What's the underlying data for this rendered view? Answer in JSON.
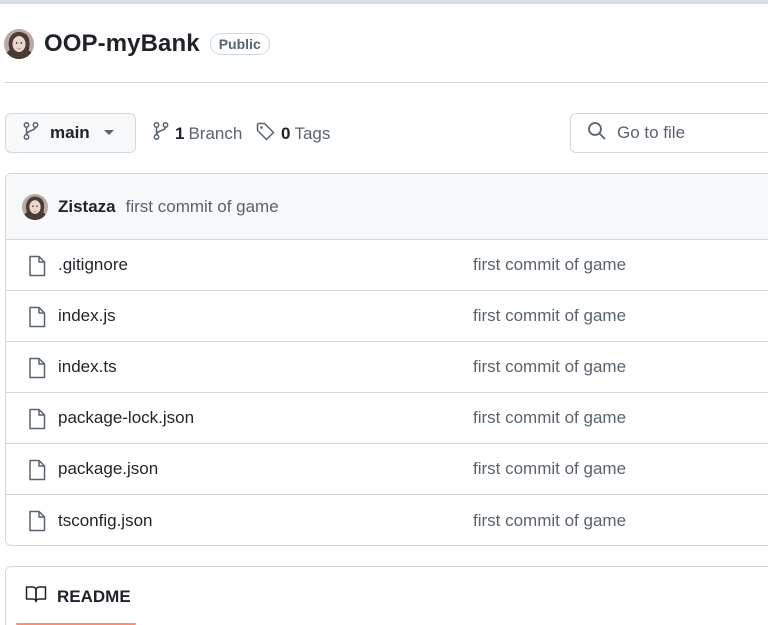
{
  "repo": {
    "name": "OOP-myBank",
    "visibility": "Public",
    "owner_avatar": "avatar"
  },
  "toolbar": {
    "branch": "main",
    "branch_count": "1",
    "branch_word": "Branch",
    "tag_count": "0",
    "tag_word": "Tags",
    "search_placeholder": "Go to file"
  },
  "commit": {
    "author": "Zistaza",
    "message": "first commit of game"
  },
  "files": [
    {
      "name": ".gitignore",
      "commit": "first commit of game",
      "icon": "file-icon"
    },
    {
      "name": "index.js",
      "commit": "first commit of game",
      "icon": "file-icon"
    },
    {
      "name": "index.ts",
      "commit": "first commit of game",
      "icon": "file-icon"
    },
    {
      "name": "package-lock.json",
      "commit": "first commit of game",
      "icon": "file-icon"
    },
    {
      "name": "package.json",
      "commit": "first commit of game",
      "icon": "file-icon"
    },
    {
      "name": "tsconfig.json",
      "commit": "first commit of game",
      "icon": "file-icon"
    }
  ],
  "readme": {
    "label": "README",
    "icon": "book-icon"
  },
  "colors": {
    "border": "#d1d9e0",
    "muted": "#59636e",
    "text": "#1f2328",
    "readme_underline": "#fd8c73"
  }
}
